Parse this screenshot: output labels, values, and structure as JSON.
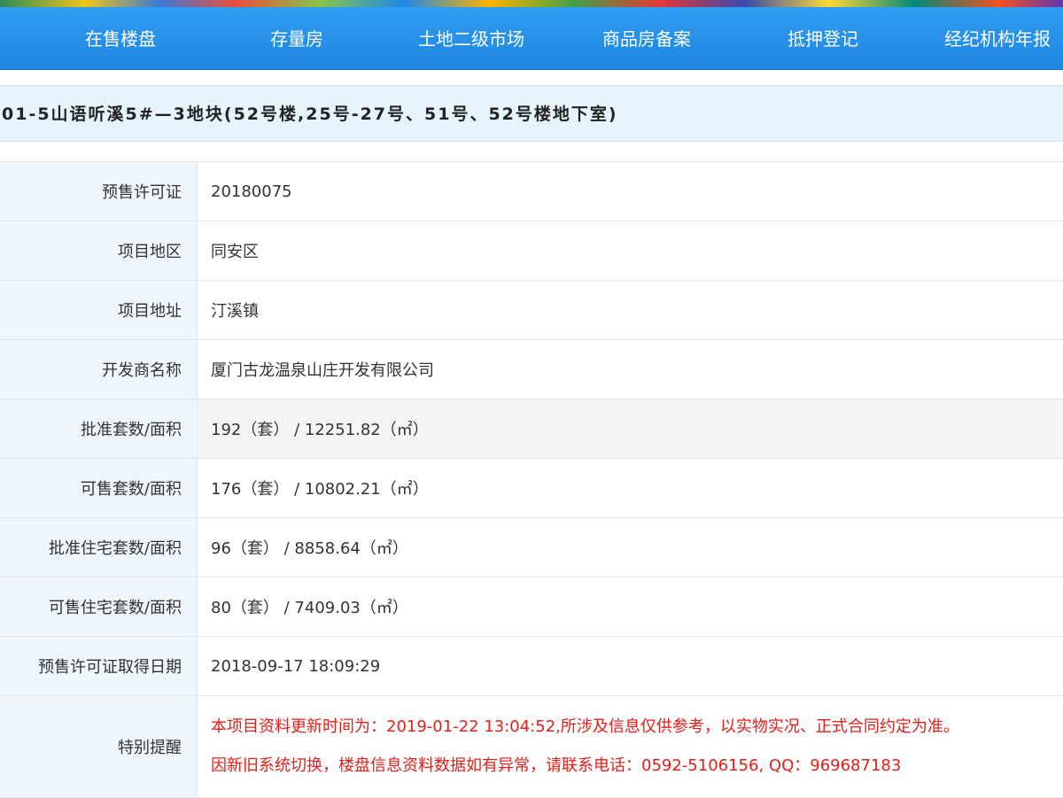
{
  "nav": {
    "items": [
      "在售楼盘",
      "存量房",
      "土地二级市场",
      "商品房备案",
      "抵押登记",
      "经纪机构年报"
    ]
  },
  "title": "01-5山语听溪5#—3地块(52号楼,25号-27号、51号、52号楼地下室)",
  "details": [
    {
      "label": "预售许可证",
      "value": "20180075"
    },
    {
      "label": "项目地区",
      "value": "同安区"
    },
    {
      "label": "项目地址",
      "value": "汀溪镇"
    },
    {
      "label": "开发商名称",
      "value": "厦门古龙温泉山庄开发有限公司"
    },
    {
      "label": "批准套数/面积",
      "value": "192（套） / 12251.82（㎡）"
    },
    {
      "label": "可售套数/面积",
      "value": "176（套） / 10802.21（㎡）"
    },
    {
      "label": "批准住宅套数/面积",
      "value": "96（套） / 8858.64（㎡）"
    },
    {
      "label": "可售住宅套数/面积",
      "value": "80（套） / 7409.03（㎡）"
    },
    {
      "label": "预售许可证取得日期",
      "value": "2018-09-17 18:09:29"
    }
  ],
  "notice": {
    "label": "特别提醒",
    "line1": "本项目资料更新时间为：2019-01-22 13:04:52,所涉及信息仅供参考，以实物实况、正式合同约定为准。",
    "line2": "因新旧系统切换，楼盘信息资料数据如有异常，请联系电话：0592-5106156, QQ：969687183"
  },
  "colors": {
    "nav_blue": "#2f9cf0",
    "label_bg": "#eef6fc",
    "notice_red": "#e0201a"
  }
}
